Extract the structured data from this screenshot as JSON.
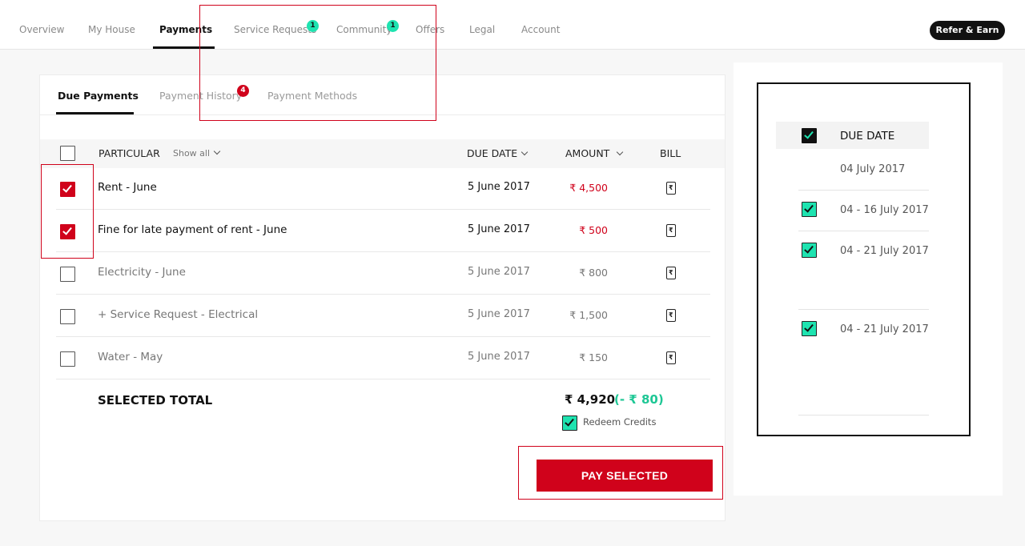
{
  "nav": {
    "items": [
      {
        "label": "Overview"
      },
      {
        "label": "My House"
      },
      {
        "label": "Payments"
      },
      {
        "label": "Service Requests",
        "badge": "1"
      },
      {
        "label": "Community",
        "badge": "1"
      },
      {
        "label": "Offers"
      },
      {
        "label": "Legal"
      },
      {
        "label": "Account"
      }
    ],
    "refer_label": "Refer & Earn"
  },
  "subtabs": [
    {
      "label": "Due Payments"
    },
    {
      "label": "Payment History",
      "badge": "4"
    },
    {
      "label": "Payment Methods"
    }
  ],
  "table": {
    "headers": {
      "particular": "PARTICULAR",
      "show_all": "Show all",
      "due_date": "DUE DATE",
      "amount": "AMOUNT",
      "bill": "BILL"
    },
    "rows": [
      {
        "particular": "Rent - June",
        "date": "5 June 2017",
        "amount": "₹ 4,500",
        "selected": true
      },
      {
        "particular": "Fine for late payment of rent - June",
        "date": "5 June 2017",
        "amount": "₹ 500",
        "selected": true
      },
      {
        "particular": "Electricity - June",
        "date": "5 June 2017",
        "amount": "₹ 800",
        "selected": false
      },
      {
        "particular": "+ Service Request - Electrical",
        "date": "5 June 2017",
        "amount": "₹ 1,500",
        "selected": false
      },
      {
        "particular": "Water - May",
        "date": "5 June 2017",
        "amount": "₹ 150",
        "selected": false
      }
    ],
    "bill_icon": "rupee-bill-icon"
  },
  "total": {
    "label": "SELECTED TOTAL",
    "amount": "₹ 4,920",
    "discount": "(- ₹ 80)",
    "redeem_label": "Redeem Credits"
  },
  "pay_button": "PAY SELECTED",
  "side_panel": {
    "header": "DUE DATE",
    "dates": [
      "04 July 2017",
      "04 - 16 July 2017",
      "04 - 21 July 2017",
      "04 - 21 July 2017"
    ]
  },
  "colors": {
    "accent_red": "#d0021b",
    "accent_teal": "#1ee3b0",
    "text_dark": "#111111"
  }
}
